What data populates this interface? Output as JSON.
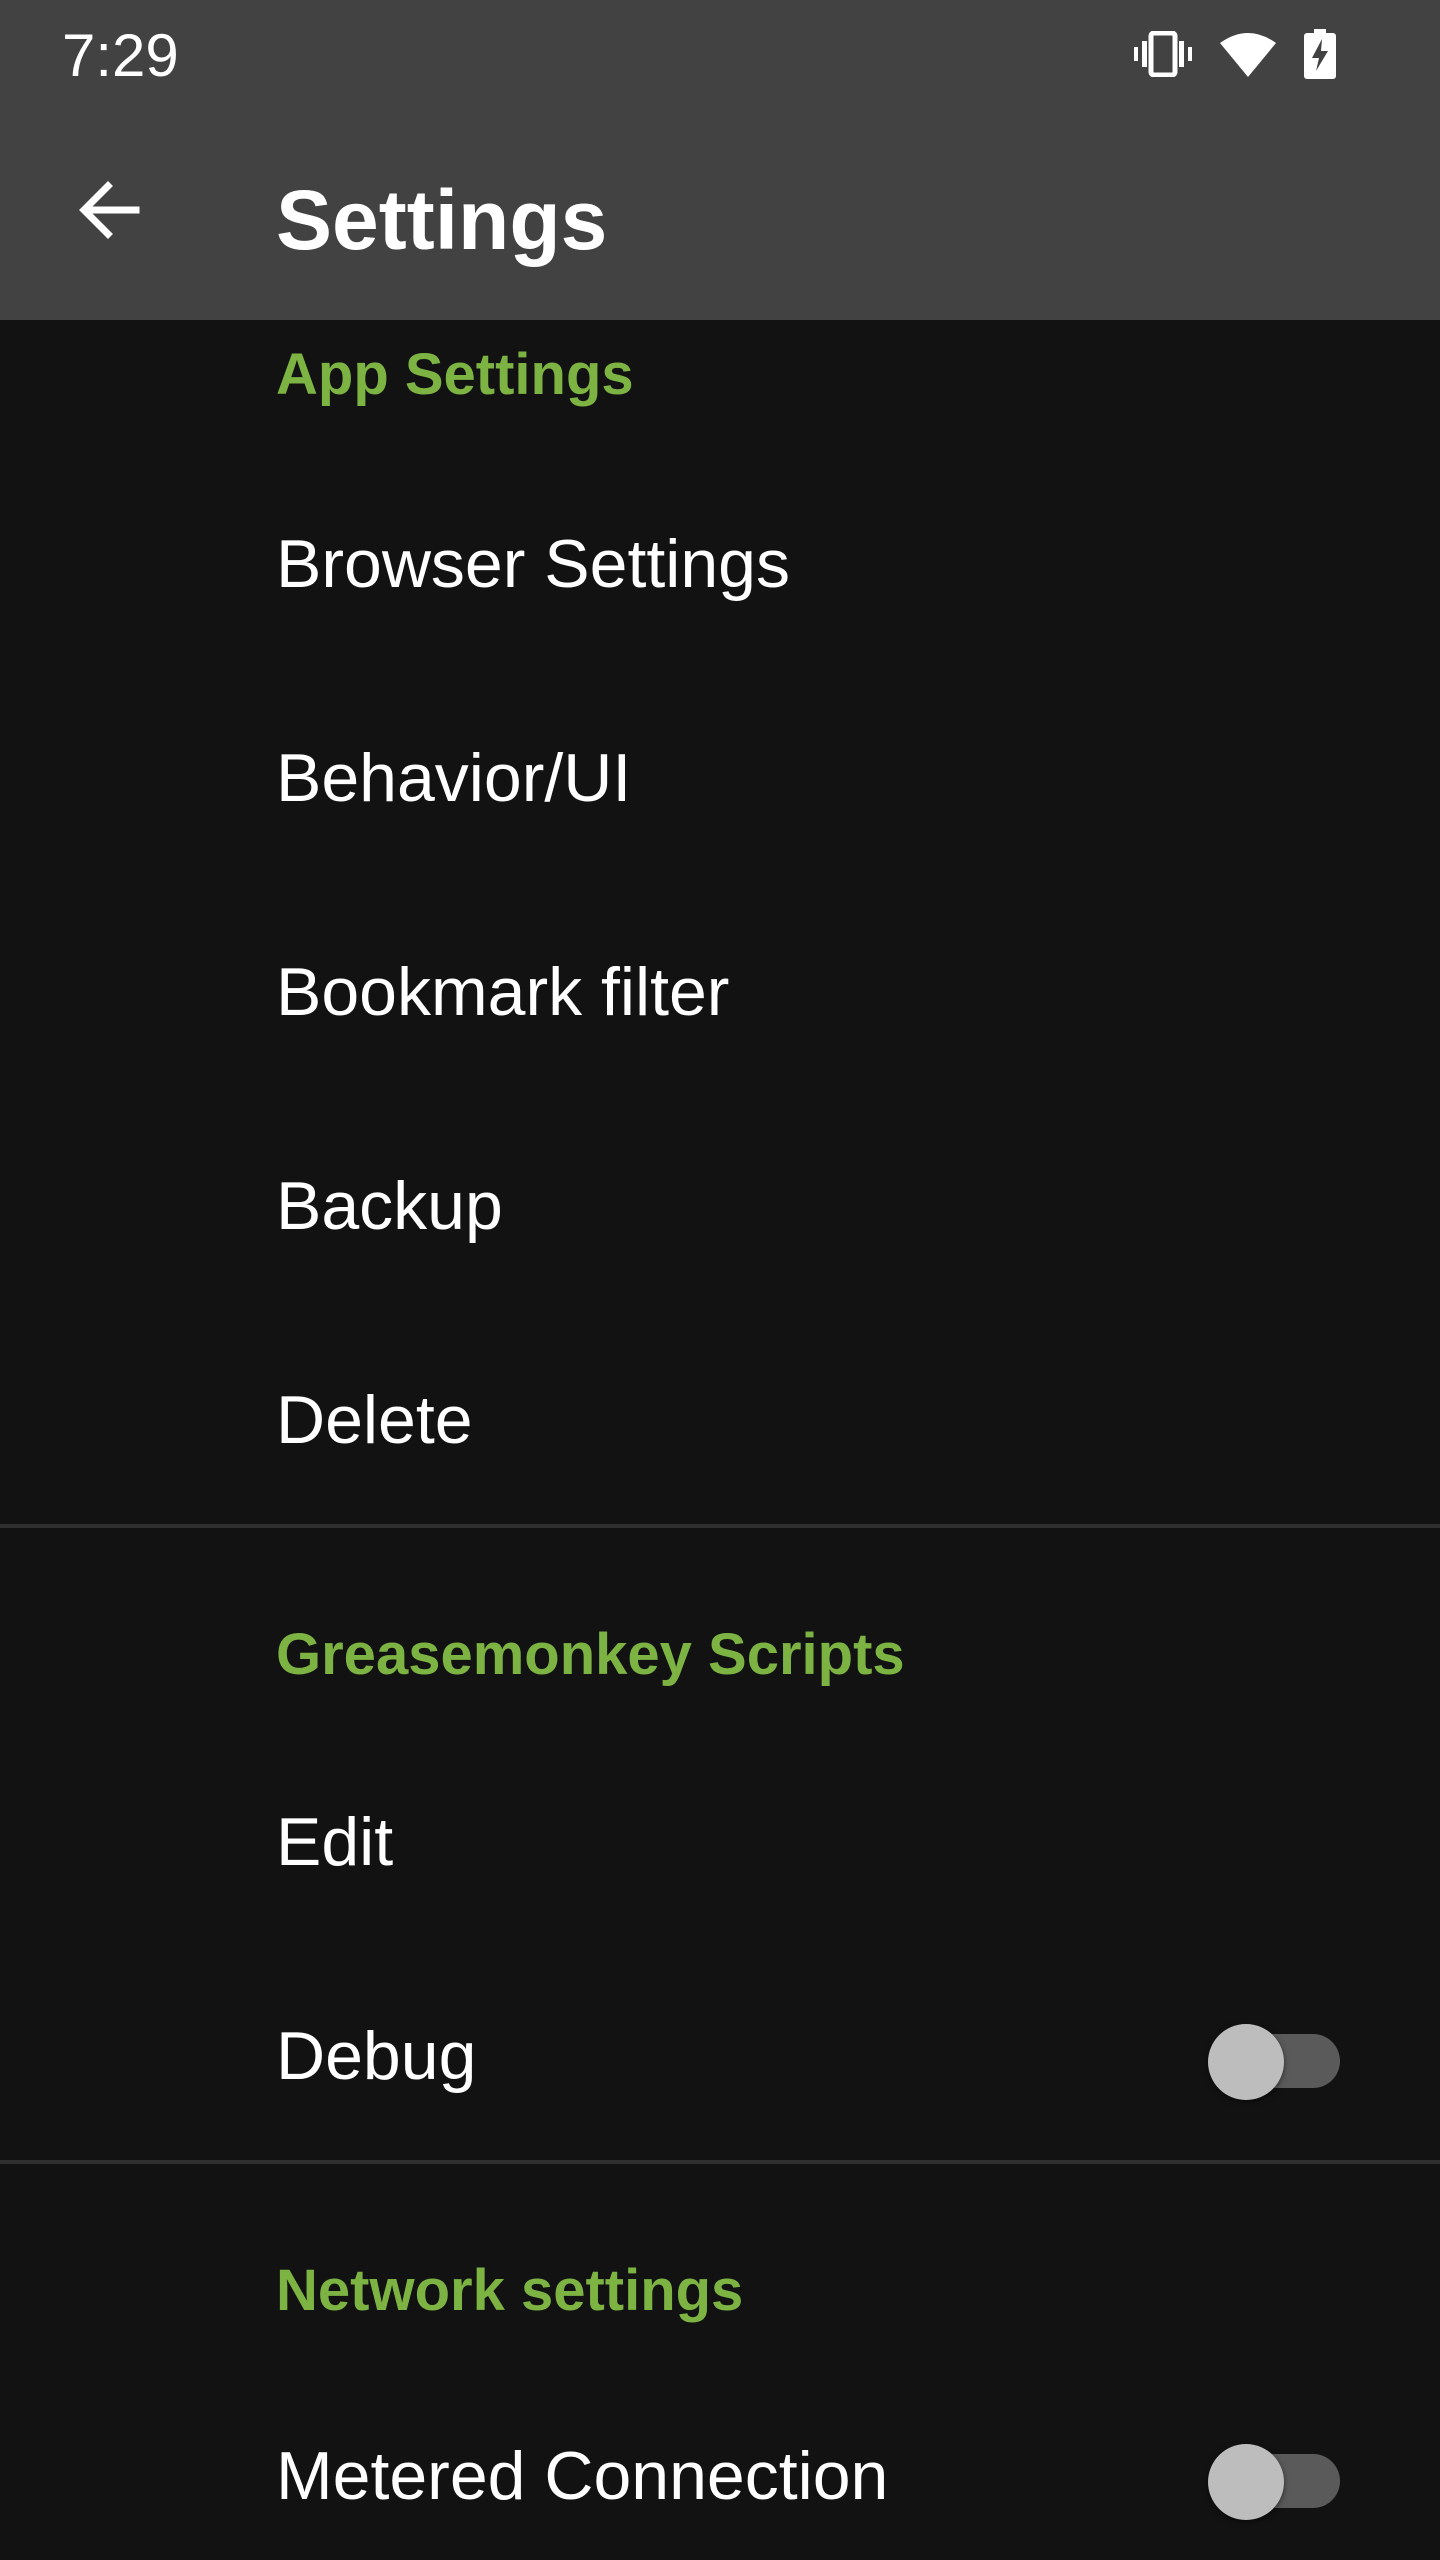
{
  "status_bar": {
    "time": "7:29",
    "icons": [
      "vibrate-icon",
      "wifi-icon",
      "battery-charging-icon"
    ]
  },
  "toolbar": {
    "title": "Settings",
    "back_icon": "arrow-back-icon"
  },
  "colors": {
    "appbar": "#424242",
    "background": "#121212",
    "accent": "#7cb342",
    "text": "#ffffff",
    "divider": "#2f2f2f",
    "switch_thumb": "#bdbdbd",
    "switch_track": "#5a5a5a"
  },
  "sections": {
    "app_settings": {
      "header": "App Settings",
      "items": [
        {
          "label": "Browser Settings"
        },
        {
          "label": "Behavior/UI"
        },
        {
          "label": "Bookmark filter"
        },
        {
          "label": "Backup"
        },
        {
          "label": "Delete"
        }
      ]
    },
    "greasemonkey": {
      "header": "Greasemonkey Scripts",
      "items": [
        {
          "label": "Edit"
        },
        {
          "label": "Debug",
          "toggle": false
        }
      ]
    },
    "network": {
      "header": "Network settings",
      "items": [
        {
          "label": "Metered Connection",
          "toggle": false
        }
      ]
    }
  }
}
